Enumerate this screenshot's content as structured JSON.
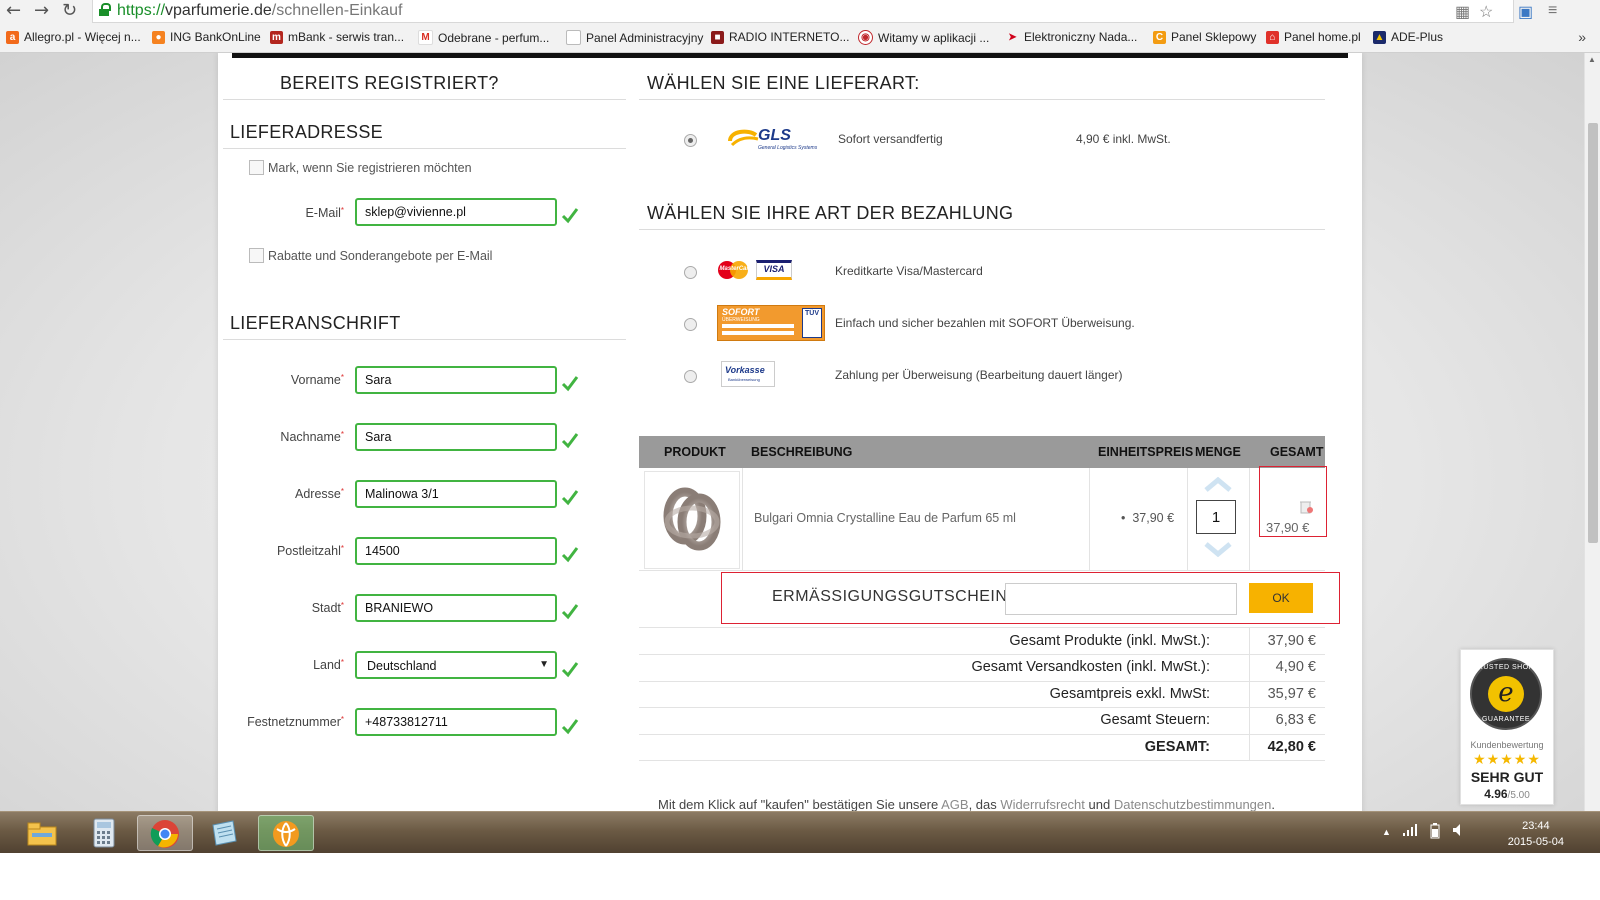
{
  "browser": {
    "url_protocol": "https://",
    "url_host": "vparfumerie.de",
    "url_path": "/schnellen-Einkauf",
    "nav": {
      "back": "←",
      "forward": "→",
      "reload": "↻"
    },
    "bookmarks": [
      {
        "label": "Allegro.pl - Więcej n...",
        "icon": "allegro-icon",
        "color": "#f26a1b"
      },
      {
        "label": "ING BankOnLine",
        "icon": "ing-icon",
        "color": "#f58220"
      },
      {
        "label": "mBank - serwis tran...",
        "icon": "mbank-icon",
        "color": "#b3261e"
      },
      {
        "label": "Odebrane - perfum...",
        "icon": "gmail-icon",
        "color": "#d93025"
      },
      {
        "label": "Panel Administracyjny",
        "icon": "page-icon",
        "color": "#bbbbbb"
      },
      {
        "label": "RADIO INTERNETO...",
        "icon": "radio-icon",
        "color": "#8b1a1a"
      },
      {
        "label": "Witamy w aplikacji ...",
        "icon": "app-icon",
        "color": "#c0282d"
      },
      {
        "label": "Elektroniczny Nada...",
        "icon": "poczta-icon",
        "color": "#d0021b"
      },
      {
        "label": "Panel Sklepowy",
        "icon": "shop-icon",
        "color": "#f39c12"
      },
      {
        "label": "Panel home.pl",
        "icon": "homepl-icon",
        "color": "#e0312a"
      },
      {
        "label": "ADE-Plus",
        "icon": "ade-icon",
        "color": "#1b2a6b"
      }
    ],
    "bookmarks_more": "»"
  },
  "left": {
    "registered_heading": "BEREITS REGISTRIERT?",
    "delivery_heading": "LIEFERADRESSE",
    "register_checkbox_label": "Mark, wenn Sie registrieren möchten",
    "email_label": "E-Mail",
    "email_value": "sklep@vivienne.pl",
    "newsletter_checkbox_label": "Rabatte und Sonderangebote per E-Mail",
    "address_heading": "LIEFERANSCHRIFT",
    "fields": [
      {
        "label": "Vorname",
        "value": "Sara"
      },
      {
        "label": "Nachname",
        "value": "Sara"
      },
      {
        "label": "Adresse",
        "value": "Malinowa 3/1"
      },
      {
        "label": "Postleitzahl",
        "value": "14500"
      },
      {
        "label": "Stadt",
        "value": "BRANIEWO"
      }
    ],
    "country_label": "Land",
    "country_value": "Deutschland",
    "phone_label": "Festnetznummer",
    "phone_value": "+48733812711"
  },
  "shipping": {
    "heading": "WÄHLEN SIE EINE LIEFERART:",
    "carrier_logo": "GLS",
    "carrier_sub": "General Logistics Systems",
    "option_label": "Sofort versandfertig",
    "option_price": "4,90 € inkl. MwSt."
  },
  "payment": {
    "heading": "WÄHLEN SIE IHRE ART DER BEZAHLUNG",
    "options": [
      {
        "label": "Kreditkarte Visa/Mastercard",
        "logo": "mastercard-visa-logo"
      },
      {
        "label": "Einfach und sicher bezahlen mit SOFORT Überweisung.",
        "logo": "sofort-logo"
      },
      {
        "label": "Zahlung per Überweisung (Bearbeitung dauert länger)",
        "logo": "vorkasse-logo"
      }
    ],
    "logo_texts": {
      "mastercard": "MasterCard",
      "visa": "VISA",
      "sofort": "SOFORT",
      "sofort_sub": "ÜBERWEISUNG",
      "tuv": "TÜV",
      "vorkasse": "Vorkasse",
      "vorkasse_sub": "Banküberweisung"
    }
  },
  "cart": {
    "headers": {
      "product": "PRODUKT",
      "description": "BESCHREIBUNG",
      "unit_price": "EINHEITSPREIS",
      "quantity": "MENGE",
      "total": "GESAMT"
    },
    "item": {
      "description": "Bulgari Omnia Crystalline Eau de Parfum 65 ml",
      "unit_price": "37,90 €",
      "quantity": "1",
      "total": "37,90 €"
    },
    "coupon_label": "ERMÄSSIGUNGSGUTSCHEINE",
    "coupon_button": "OK",
    "totals": [
      {
        "label": "Gesamt Produkte (inkl. MwSt.):",
        "value": "37,90 €"
      },
      {
        "label": "Gesamt Versandkosten (inkl. MwSt.):",
        "value": "4,90 €"
      },
      {
        "label": "Gesamtpreis exkl. MwSt:",
        "value": "35,97 €"
      },
      {
        "label": "Gesamt Steuern:",
        "value": "6,83 €"
      },
      {
        "label": "GESAMT:",
        "value": "42,80 €"
      }
    ]
  },
  "footer_note": {
    "before": "Mit dem Klick auf \"kaufen\" bestätigen Sie unsere ",
    "agb": "AGB",
    "mid1": ", das ",
    "widerruf": "Widerrufsrecht",
    "mid2": " und ",
    "datenschutz": "Datenschutzbestimmungen",
    "after": "."
  },
  "trusted_shops": {
    "seal_top": "TRUSTED SHOPS",
    "seal_bottom": "GUARANTEE",
    "seal_letter": "e",
    "caption": "Kundenbewertung",
    "stars": "★★★★★",
    "rating_text": "SEHR GUT",
    "score": "4.96",
    "score_max": "/5.00"
  },
  "taskbar": {
    "time": "23:44",
    "date": "2015-05-04",
    "apps": [
      "explorer-icon",
      "calculator-icon",
      "chrome-icon",
      "notes-icon",
      "app-orange-icon"
    ]
  },
  "colors": {
    "valid_green": "#41b441",
    "accent_yellow": "#f7b200",
    "highlight_red": "#d23"
  }
}
